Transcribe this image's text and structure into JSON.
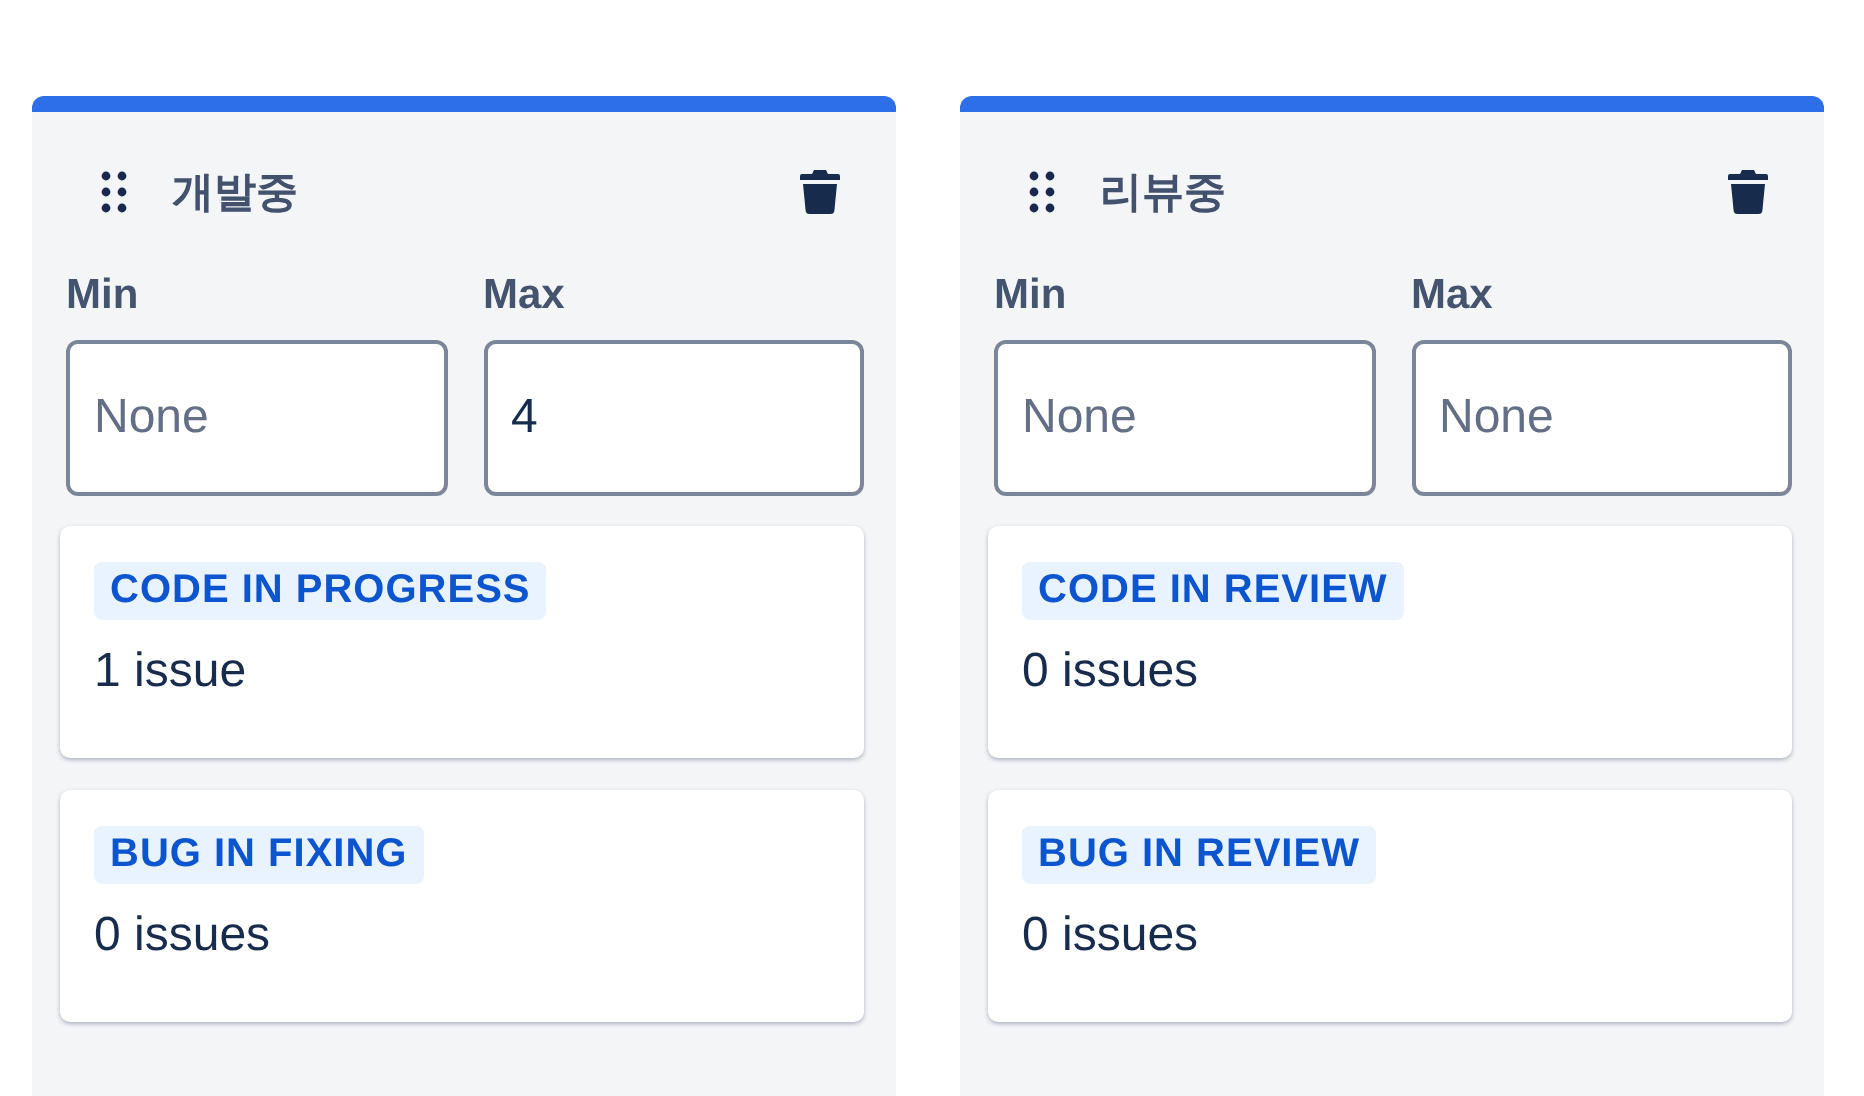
{
  "columns": [
    {
      "title": "개발중",
      "min": {
        "label": "Min",
        "placeholder": "None"
      },
      "max": {
        "label": "Max",
        "value": "4"
      },
      "statuses": [
        {
          "name": "CODE IN PROGRESS",
          "count": "1 issue"
        },
        {
          "name": "BUG IN FIXING",
          "count": "0 issues"
        }
      ]
    },
    {
      "title": "리뷰중",
      "min": {
        "label": "Min",
        "placeholder": "None"
      },
      "max": {
        "label": "Max",
        "placeholder": "None"
      },
      "statuses": [
        {
          "name": "CODE IN REVIEW",
          "count": "0 issues"
        },
        {
          "name": "BUG IN REVIEW",
          "count": "0 issues"
        }
      ]
    }
  ]
}
